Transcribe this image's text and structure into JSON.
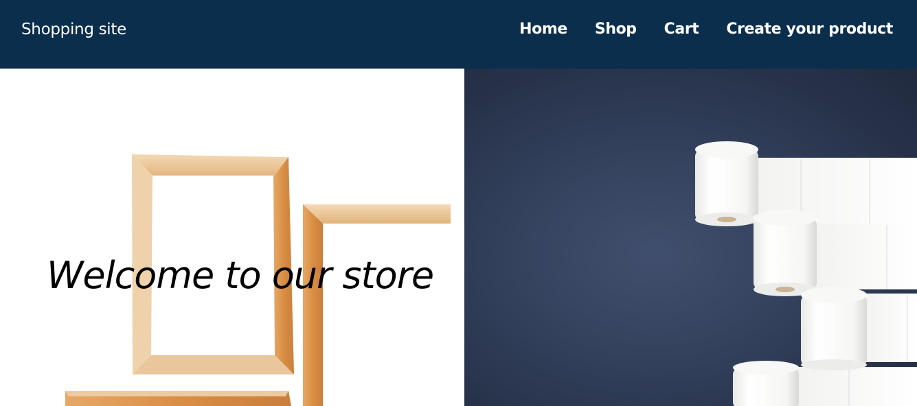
{
  "header": {
    "brand": "Shopping site",
    "nav": [
      {
        "label": "Home"
      },
      {
        "label": "Shop"
      },
      {
        "label": "Cart"
      },
      {
        "label": "Create your product"
      }
    ]
  },
  "hero": {
    "heading": "Welcome to our store",
    "left_image": "wooden-frames-image",
    "right_image": "toilet-paper-rolls-image"
  },
  "colors": {
    "navbar_bg": "#0a2e4c",
    "nav_text": "#ffffff",
    "hero_right_bg": "#35435f"
  }
}
